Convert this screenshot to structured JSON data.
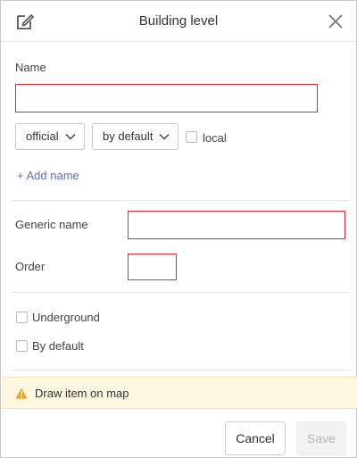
{
  "dialog": {
    "title": "Building level",
    "icons": {
      "edit": "edit-icon",
      "close": "close-icon"
    }
  },
  "name_section": {
    "label": "Name",
    "input_value": "",
    "type_select": "official",
    "lang_select": "by default",
    "local_label": "local",
    "local_checked": false,
    "add_name_link": "+ Add name"
  },
  "generic_name": {
    "label": "Generic name",
    "value": ""
  },
  "order": {
    "label": "Order",
    "value": ""
  },
  "options": {
    "underground": {
      "label": "Underground",
      "checked": false
    },
    "by_default": {
      "label": "By default",
      "checked": false
    }
  },
  "warning": {
    "text": "Draw item on map",
    "icon": "warning-icon"
  },
  "footer": {
    "cancel_label": "Cancel",
    "save_label": "Save"
  },
  "colors": {
    "error_border": "#e0282e",
    "link": "#5b74b8",
    "warning_bg": "#fdf7df",
    "warning_icon": "#f0a020"
  }
}
